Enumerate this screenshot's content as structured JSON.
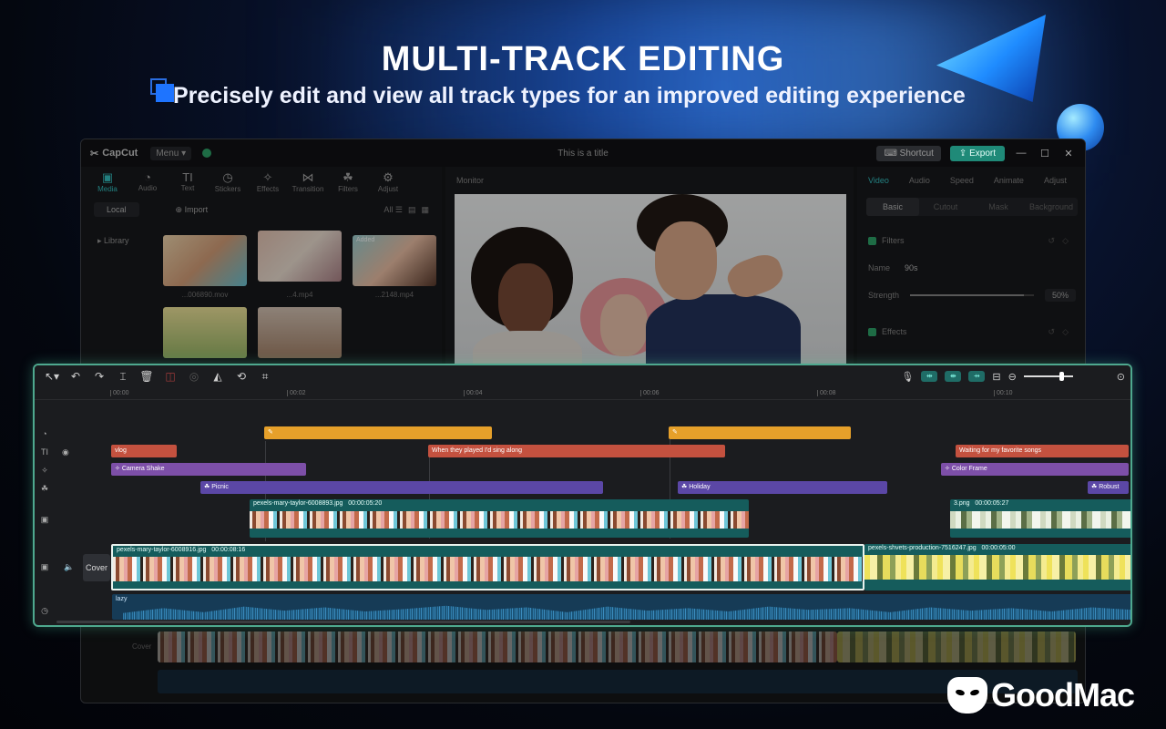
{
  "hero": {
    "title": "MULTI-TRACK EDITING",
    "subtitle": "Precisely edit and view all track types for an improved editing experience"
  },
  "app": {
    "logo": "CapCut",
    "menu_label": "Menu",
    "doc_title": "This is a title",
    "shortcut_label": "Shortcut",
    "export_label": "Export",
    "tools": [
      "Media",
      "Audio",
      "Text",
      "Stickers",
      "Effects",
      "Transition",
      "Filters",
      "Adjust"
    ],
    "local_label": "Local",
    "import_label": "Import",
    "all_label": "All",
    "library_label": "Library",
    "added_badge": "Added",
    "thumb_captions": [
      "...006890.mov",
      "...4.mp4",
      "...2148.mp4"
    ],
    "monitor_label": "Monitor",
    "prop_tabs": [
      "Video",
      "Audio",
      "Speed",
      "Animate",
      "Adjust"
    ],
    "prop_subtabs": [
      "Basic",
      "Cutout",
      "Mask",
      "Background"
    ],
    "filters_label": "Filters",
    "name_label": "Name",
    "name_value": "90s",
    "strength_label": "Strength",
    "strength_value": "50%",
    "effects_label": "Effects",
    "bg_cover_label": "Cover"
  },
  "timeline": {
    "ruler": [
      "00:00",
      "00:02",
      "00:04",
      "00:06",
      "00:08",
      "00:10"
    ],
    "cover_label": "Cover",
    "text_clips": [
      "vlog",
      "When they played I'd sing along",
      "Waiting for my favorite songs"
    ],
    "effect_clips": [
      "Camera Shake",
      "Color Frame"
    ],
    "filter_clips": [
      "Picnic",
      "Holiday",
      "Robust"
    ],
    "overlay_clips": [
      {
        "name": "pexels-mary-taylor-6008893.jpg",
        "duration": "00:00:05:20"
      },
      {
        "name": "3.png",
        "duration": "00:00:05:27"
      }
    ],
    "main_clips": [
      {
        "name": "pexels-mary-taylor-6008916.jpg",
        "duration": "00:00:08:16"
      },
      {
        "name": "pexels-shvets-production-7516247.jpg",
        "duration": "00:00:05:00"
      }
    ],
    "audio_clip": "lazy"
  },
  "brand": {
    "name": "GoodMac"
  }
}
